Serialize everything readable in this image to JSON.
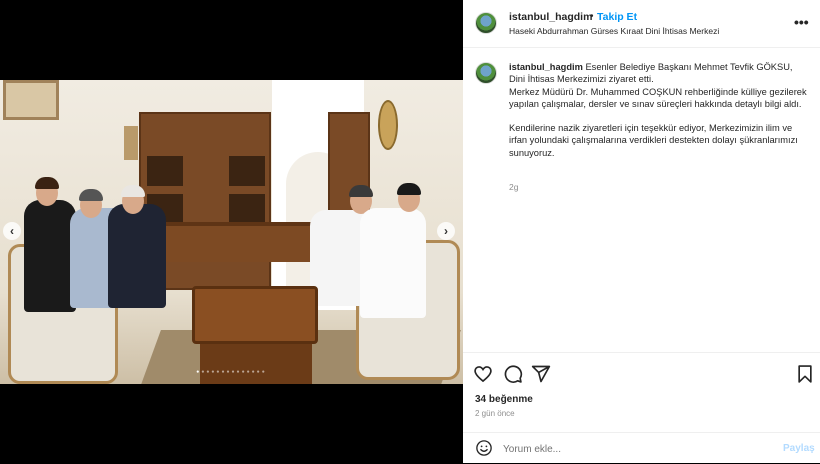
{
  "post": {
    "username": "istanbul_hagdim",
    "separator": "•",
    "follow_label": "Takip Et",
    "location": "Haseki Abdurrahman Gürses Kıraat Dini İhtisas Merkezi",
    "more_icon": "more-horizontal-icon"
  },
  "caption": {
    "username": "istanbul_hagdim",
    "line1": "Esenler Belediye Başkanı Mehmet Tevfik GÖKSU, Dini İhtisas Merkezimizi ziyaret etti.",
    "line2": "Merkez Müdürü Dr. Muhammed COŞKUN rehberliğinde külliye gezilerek yapılan çalışmalar, dersler ve sınav süreçleri hakkında detaylı bilgi aldı.",
    "line3": "Kendilerine nazik ziyaretleri için teşekkür ediyor, Merkezimizin ilim ve irfan yolundaki çalışmalarına verdikleri destekten dolayı şükranlarımızı sunuyoruz.",
    "age": "2g"
  },
  "media": {
    "carousel_count": 14,
    "carousel_active": 1,
    "prev_icon": "chevron-left-icon",
    "next_icon": "chevron-right-icon"
  },
  "actions": {
    "likes": "34 beğenme",
    "date": "2 gün önce",
    "icons": [
      "heart-icon",
      "comment-icon",
      "share-icon",
      "bookmark-icon"
    ]
  },
  "comment": {
    "placeholder": "Yorum ekle...",
    "submit_label": "Paylaş"
  },
  "colors": {
    "accent": "#0095f6",
    "submit_disabled": "#b3dbff",
    "muted": "#8e8e8e"
  }
}
